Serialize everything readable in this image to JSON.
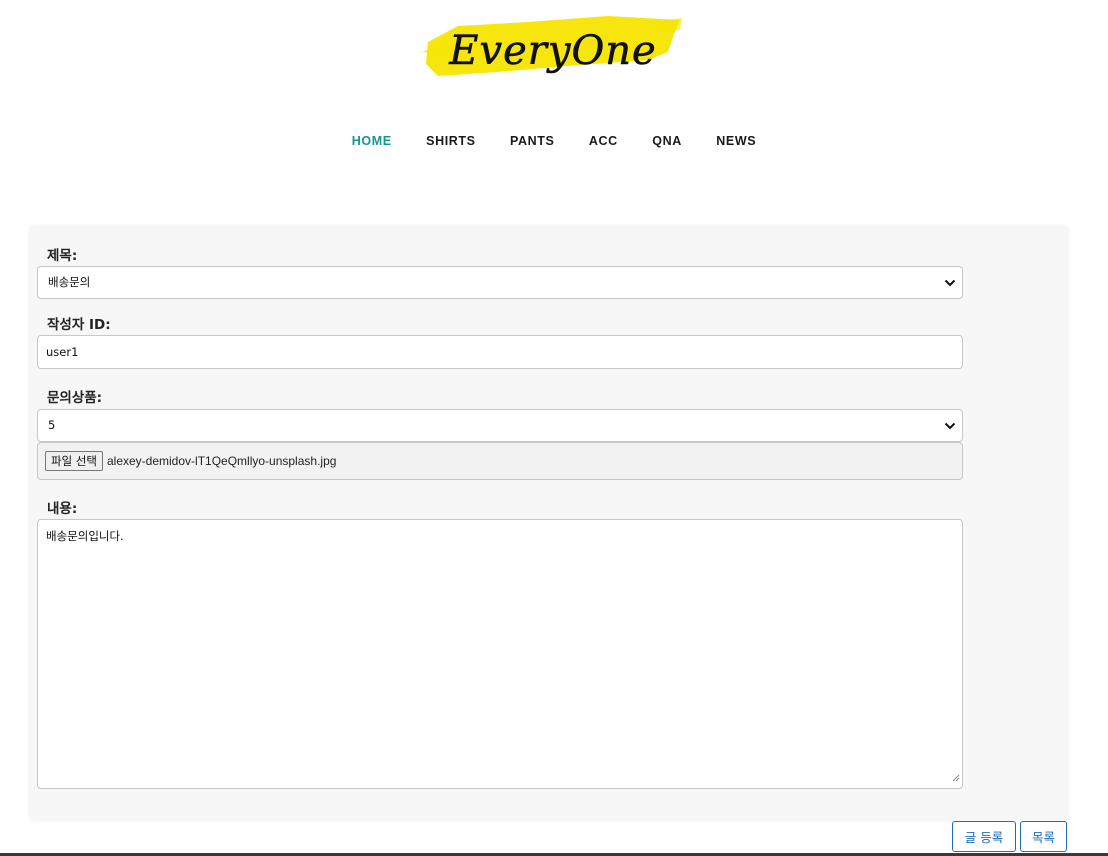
{
  "brand": {
    "logo_text": "EveryOne",
    "highlight_color": "#f7e500"
  },
  "nav": {
    "items": [
      {
        "label": "HOME",
        "active": true
      },
      {
        "label": "SHIRTS"
      },
      {
        "label": "PANTS"
      },
      {
        "label": "ACC"
      },
      {
        "label": "QNA"
      },
      {
        "label": "NEWS"
      }
    ],
    "active_color": "#14968f"
  },
  "form": {
    "title_label": "제목:",
    "title_value": "배송문의",
    "writer_label": "작성자 ID:",
    "writer_value": "user1",
    "product_label": "문의상품:",
    "product_value": "5",
    "file_button": "파일 선택",
    "file_name": "alexey-demidov-lT1QeQmllyo-unsplash.jpg",
    "content_label": "내용:",
    "content_value": "배송문의입니다."
  },
  "actions": {
    "submit_label": "글 등록",
    "list_label": "목록",
    "accent_color": "#1f6fb6"
  }
}
